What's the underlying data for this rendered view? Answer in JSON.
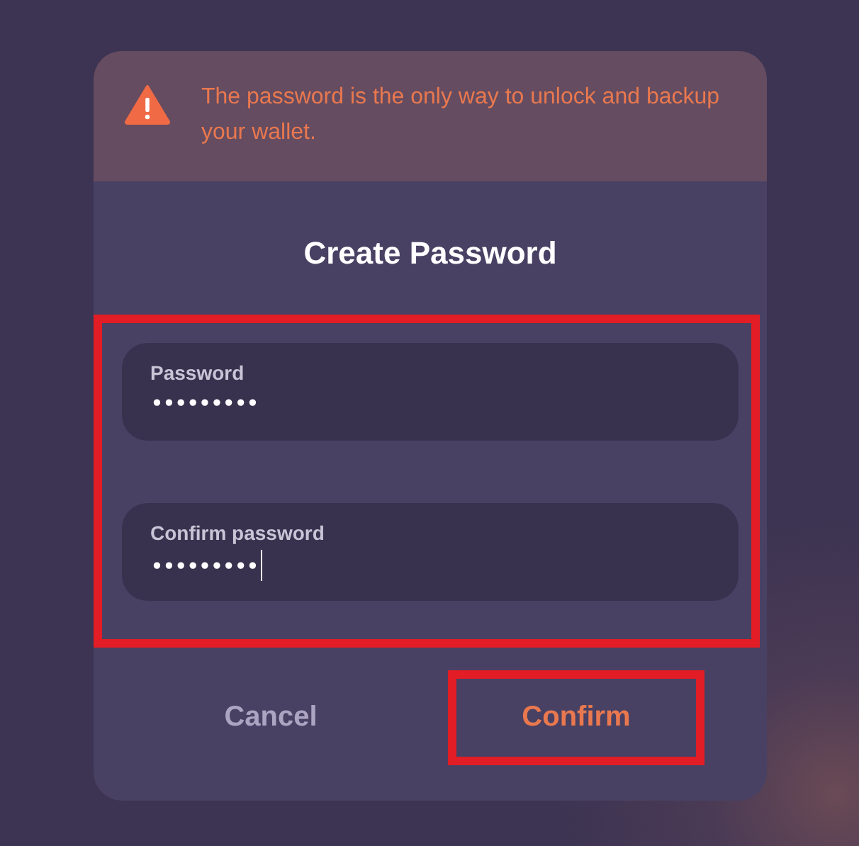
{
  "alert": {
    "message": "The password is the only way to unlock and backup your wallet."
  },
  "title": "Create Password",
  "fields_highlighted": true,
  "fields": [
    {
      "label": "Password",
      "value": "•••••••••",
      "focused": false
    },
    {
      "label": "Confirm password",
      "value": "•••••••••",
      "focused": true
    }
  ],
  "buttons": [
    {
      "label": "Cancel",
      "kind": "secondary",
      "highlighted": false
    },
    {
      "label": "Confirm",
      "kind": "primary",
      "highlighted": true
    }
  ]
}
